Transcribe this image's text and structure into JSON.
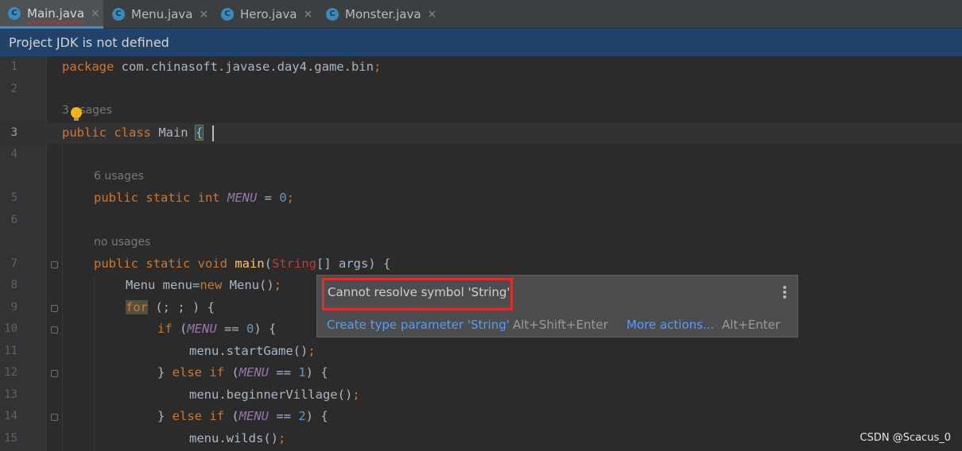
{
  "tabs": [
    {
      "label": "Main.java",
      "icon": "C",
      "active": true
    },
    {
      "label": "Menu.java",
      "icon": "C",
      "active": false
    },
    {
      "label": "Hero.java",
      "icon": "C",
      "active": false
    },
    {
      "label": "Monster.java",
      "icon": "C",
      "active": false
    }
  ],
  "tab_close_glyph": "×",
  "banner": {
    "text": "Project JDK is not defined"
  },
  "line_numbers": [
    "1",
    "2",
    "3",
    "4",
    "5",
    "6",
    "7",
    "8",
    "9",
    "10",
    "11",
    "12",
    "13",
    "14",
    "15"
  ],
  "hints": {
    "class_usages": "3 usages",
    "menu_usages": "6 usages",
    "main_usages": "no usages"
  },
  "code": {
    "l1": {
      "kw": "package",
      "rest": " com.chinasoft.javase.day4.game.bin",
      "semi": ";"
    },
    "l3": {
      "kw": "public class",
      "name": " Main ",
      "brace": "{"
    },
    "l5": {
      "kw": "public static int ",
      "field": "MENU",
      "rest": " = ",
      "num": "0",
      "semi": ";"
    },
    "l7": {
      "kw": "public static void ",
      "fn": "main",
      "p1": "(",
      "err": "String",
      "rest": "[] args) {"
    },
    "l8": {
      "p1": "Menu menu=",
      "kw": "new ",
      "p2": "Menu()",
      "semi": ";"
    },
    "l9": {
      "kw": "for",
      "rest": " (; ; ) {"
    },
    "l10": {
      "kw": "if ",
      "p1": "(",
      "field": "MENU",
      "p2": " == ",
      "num": "0",
      "p3": ") {"
    },
    "l11": {
      "text": "menu.startGame()",
      "semi": ";"
    },
    "l12": {
      "p0": "} ",
      "kw": "else if ",
      "p1": "(",
      "field": "MENU",
      "p2": " == ",
      "num": "1",
      "p3": ") {"
    },
    "l13": {
      "text": "menu.beginnerVillage()",
      "semi": ";"
    },
    "l14": {
      "p0": "} ",
      "kw": "else if ",
      "p1": "(",
      "field": "MENU",
      "p2": " == ",
      "num": "2",
      "p3": ") {"
    },
    "l15": {
      "text": "menu.wilds()",
      "semi": ";"
    }
  },
  "popup": {
    "message": "Cannot resolve symbol 'String'",
    "action1": "Create type parameter 'String'",
    "shortcut1": "Alt+Shift+Enter",
    "action2": "More actions...",
    "shortcut2": "Alt+Enter"
  },
  "watermark": "CSDN @Scacus_0",
  "colors": {
    "keyword": "#cc7832",
    "field": "#9876aa",
    "number": "#6897bb",
    "function": "#ffc66d",
    "link": "#589df6",
    "banner": "#224369",
    "error_border": "#e02b2b"
  }
}
